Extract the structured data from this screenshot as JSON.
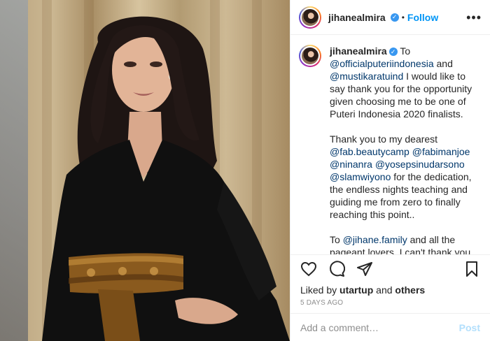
{
  "header": {
    "username": "jihanealmira",
    "separator": "•",
    "follow_label": "Follow"
  },
  "caption": {
    "username": "jihanealmira",
    "intro": " To",
    "mention_1": "@officialputeriindonesia",
    "text_1": " and",
    "mention_2": "@mustikaratuind",
    "text_2": " I would like to say thank you for the opportunity given choosing me to be one of Puteri Indonesia 2020 finalists.",
    "para2_intro": "Thank you to my dearest",
    "mention_3": "@fab.beautycamp",
    "mention_4": "@fabimanjoe",
    "mention_5": "@ninanra",
    "mention_6": "@yosepsinudarsono",
    "mention_7": "@slamwiyono",
    "para2_rest": " for the dedication, the endless nights teaching and guiding me from zero to finally reaching this point..",
    "para3_intro": "To ",
    "mention_8": "@jihane.family",
    "para3_rest": " and all the pageant lovers, I can't thank you enough for the love, your advices encouraging me to be better, for truly supporting and having my back"
  },
  "likes": {
    "prefix": "Liked by ",
    "user": "utartup",
    "middle": " and ",
    "others": "others"
  },
  "timestamp": "5 DAYS AGO",
  "comment": {
    "placeholder": "Add a comment…",
    "post_label": "Post"
  },
  "colors": {
    "link_blue": "#0095f6",
    "mention_blue": "#00376b",
    "verified_blue": "#3897f0"
  },
  "icons": [
    "more-icon",
    "verified-icon",
    "heart-icon",
    "comment-icon",
    "share-icon",
    "bookmark-icon"
  ]
}
